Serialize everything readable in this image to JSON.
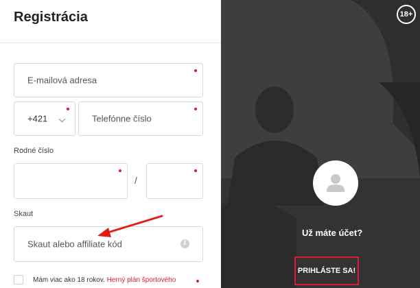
{
  "form": {
    "title": "Registrácia",
    "email_placeholder": "E-mailová adresa",
    "phone_prefix": "+421",
    "phone_placeholder": "Telefónne číslo",
    "rodne_cislo_label": "Rodné číslo",
    "rodne_cislo_separator": "/",
    "skaut_label": "Skaut",
    "skaut_placeholder": "Skaut alebo affiliate kód",
    "age_checkbox_text": "Mám viac ako 18 rokov.",
    "age_checkbox_link": "Herný plán športového"
  },
  "side": {
    "age_badge": "18+",
    "have_account": "Už máte účet?",
    "login_button": "PRIHLÁSTE SA!"
  },
  "colors": {
    "accent": "#e0193b",
    "panel_dark": "#3c3c3c",
    "annotation_arrow": "#e41b17"
  },
  "icons": {
    "chevron": "chevron-down-icon",
    "info": "info-icon",
    "avatar": "user-avatar-icon",
    "annotation": "red-arrow-annotation"
  }
}
